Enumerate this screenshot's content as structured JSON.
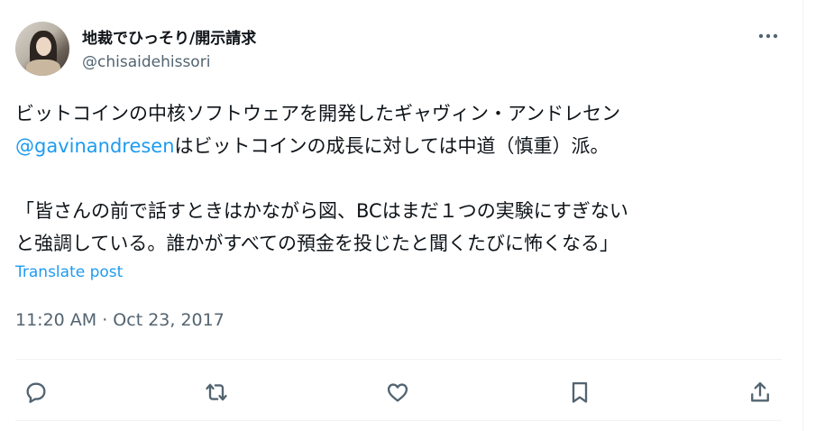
{
  "user": {
    "display_name": "地裁でひっそり/開示請求",
    "handle": "@chisaidehissori"
  },
  "tweet": {
    "line1": "ビットコインの中核ソフトウェアを開発したギャヴィン・アンドレセン",
    "line2_mention": "@gavinandresen",
    "line2_rest": "はビットコインの成長に対しては中道（慎重）派。",
    "line3": "「皆さんの前で話すときはかながら図、BCはまだ１つの実験にすぎない",
    "line4": "と強調している。誰かがすべての預金を投じたと聞くたびに怖くなる」"
  },
  "translate_label": "Translate post",
  "timestamp": "11:20 AM · Oct 23, 2017",
  "icons": {
    "more": "more-dots-icon",
    "reply": "reply-icon",
    "retweet": "retweet-icon",
    "like": "like-icon",
    "bookmark": "bookmark-icon",
    "share": "share-icon"
  },
  "colors": {
    "text": "#0f1419",
    "secondary": "#536471",
    "link": "#1d9bf0",
    "divider": "#eff3f4"
  }
}
